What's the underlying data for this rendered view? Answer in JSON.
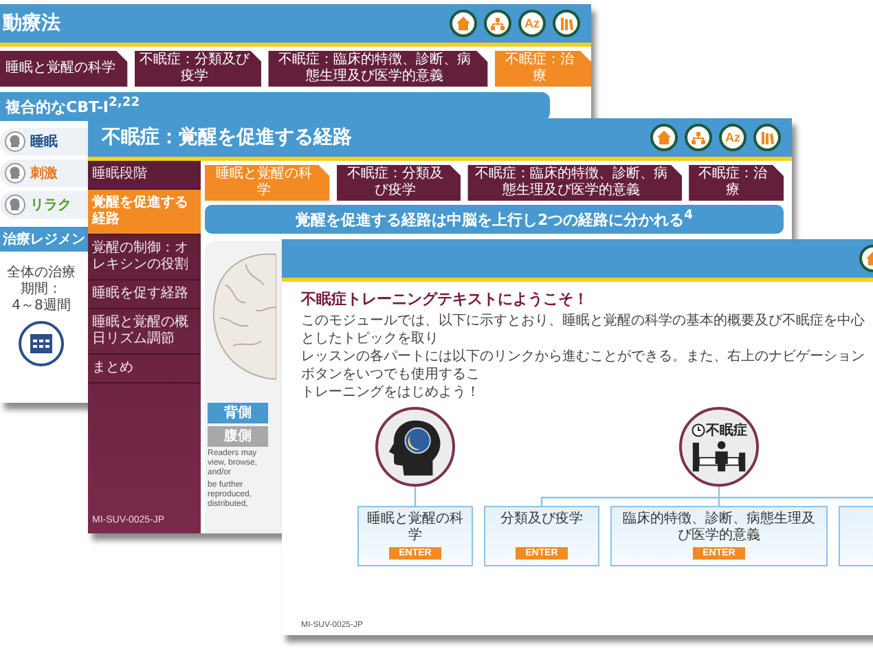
{
  "back_slide": {
    "title": "動療法",
    "nav_buttons": [
      {
        "kind": "home"
      },
      {
        "kind": "sitemap"
      },
      {
        "kind": "glossary",
        "label": "Az"
      },
      {
        "kind": "library"
      }
    ],
    "tabs": [
      {
        "label": "睡眠と覚醒の科学",
        "selected": false
      },
      {
        "label": "不眠症：分類及び疫学",
        "selected": false
      },
      {
        "label": "不眠症：臨床的特徴、診断、病態生理及び医学的意義",
        "selected": false
      },
      {
        "label": "不眠症：治療",
        "selected": true
      }
    ],
    "banner": "複合的なCBT-I$^{2,22}$",
    "techniques": [
      {
        "label": "睡眠",
        "color": "#1f4e8c"
      },
      {
        "label": "刺激",
        "color": "#e8781e"
      },
      {
        "label": "リラク",
        "color": "#4f9a2a"
      }
    ],
    "regimen_heading": "治療レジメン",
    "duration_label": "全体の治療期間：",
    "duration_value": "4～8週間"
  },
  "middle_slide": {
    "title": "不眠症：覚醒を促進する経路",
    "nav_buttons": [
      {
        "kind": "home"
      },
      {
        "kind": "sitemap"
      },
      {
        "kind": "glossary",
        "label": "Az"
      },
      {
        "kind": "library"
      }
    ],
    "sidebar": {
      "items": [
        {
          "label": "睡眠段階",
          "selected": false
        },
        {
          "label": "覚醒を促進する経路",
          "selected": true
        },
        {
          "label": "覚醒の制御：オレキシンの役割",
          "selected": false
        },
        {
          "label": "睡眠を促す経路",
          "selected": false
        },
        {
          "label": "睡眠と覚醒の概日リズム調節",
          "selected": false
        },
        {
          "label": "まとめ",
          "selected": false
        }
      ],
      "footer_code": "MI-SUV-0025-JP"
    },
    "tabs": [
      {
        "label": "睡眠と覚醒の科学",
        "selected": true
      },
      {
        "label": "不眠症：分類及び疫学",
        "selected": false
      },
      {
        "label": "不眠症：臨床的特徴、診断、病態生理及び医学的意義",
        "selected": false
      },
      {
        "label": "不眠症：治療",
        "selected": false
      }
    ],
    "banner": "覚醒を促進する経路は中脳を上行し2つの経路に分かれる$^{4}$",
    "view_buttons": [
      {
        "label": "背側",
        "selected": true
      },
      {
        "label": "腹側",
        "selected": false
      }
    ],
    "footnote_lines": [
      "Readers may view, browse, and/or",
      "be further reproduced, distributed,"
    ]
  },
  "front_slide": {
    "nav_buttons": [
      {
        "kind": "home"
      }
    ],
    "heading": "不眠症トレーニングテキストにようこそ！",
    "paragraph_lines": [
      "このモジュールでは、以下に示すとおり、睡眠と覚醒の科学の基本的概要及び不眠症を中心としたトピックを取り",
      "レッスンの各パートには以下のリンクから進むことができる。また、右上のナビゲーションボタンをいつでも使用するこ",
      "トレーニングをはじめよう！"
    ],
    "circle_label": "不眠症",
    "topics": [
      {
        "label": "睡眠と覚醒の科学",
        "button": "ENTER"
      },
      {
        "label": "分類及び疫学",
        "button": "ENTER"
      },
      {
        "label": "臨床的特徴、診断、病態生理及び医学的意義",
        "button": "ENTER"
      }
    ],
    "footer_code": "MI-SUV-0025-JP"
  }
}
